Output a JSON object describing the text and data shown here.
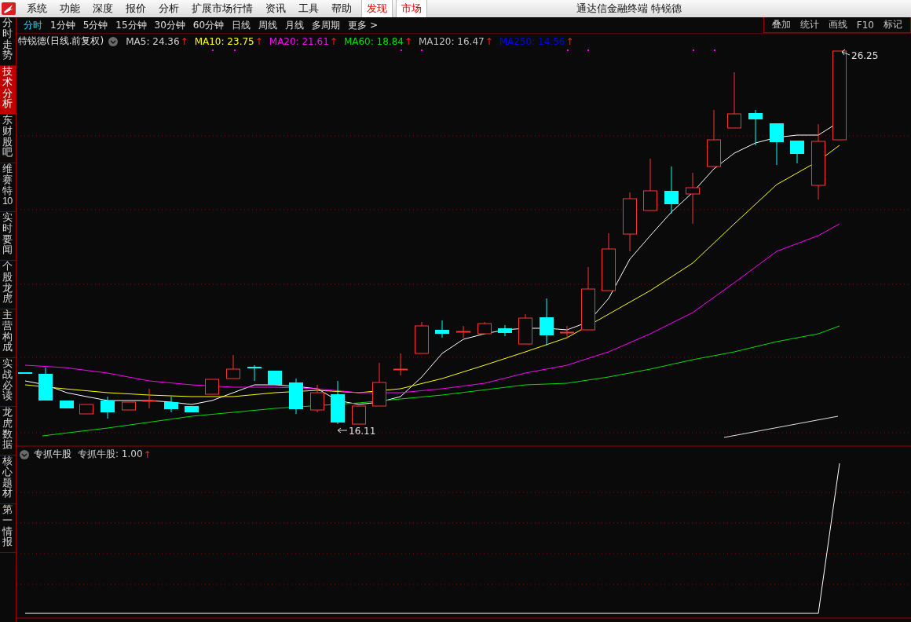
{
  "menu_bar": {
    "items": [
      "系统",
      "功能",
      "深度",
      "报价",
      "分析",
      "扩展市场行情",
      "资讯",
      "工具",
      "帮助"
    ],
    "highlight_items": [
      "发现",
      "市场"
    ],
    "title": "通达信金融终端  特锐德"
  },
  "period_tabs": [
    {
      "label": "分时",
      "selected": true
    },
    {
      "label": "1分钟",
      "selected": false
    },
    {
      "label": "5分钟",
      "selected": false
    },
    {
      "label": "15分钟",
      "selected": false
    },
    {
      "label": "30分钟",
      "selected": false
    },
    {
      "label": "60分钟",
      "selected": false
    },
    {
      "label": "日线",
      "selected": false
    },
    {
      "label": "周线",
      "selected": false
    },
    {
      "label": "月线",
      "selected": false
    },
    {
      "label": "多周期",
      "selected": false
    },
    {
      "label": "更多 >",
      "selected": false
    }
  ],
  "tool_buttons": [
    "叠加",
    "统计",
    "画线",
    "F10",
    "标记"
  ],
  "sidebar": {
    "items": [
      {
        "label": "分时走势",
        "selected": false
      },
      {
        "label": "技术分析",
        "selected": true
      },
      {
        "label": "东财股吧",
        "selected": false
      },
      {
        "label": "维赛特10",
        "selected": false
      },
      {
        "label": "实时要闻",
        "selected": false
      },
      {
        "label": "个股龙虎",
        "selected": false
      },
      {
        "label": "主营构成",
        "selected": false
      },
      {
        "label": "实战必读",
        "selected": false
      },
      {
        "label": "龙虎数据",
        "selected": false
      },
      {
        "label": "核心题材",
        "selected": false
      },
      {
        "label": "第一情报",
        "selected": false
      }
    ]
  },
  "main_chart": {
    "title": "特锐德(日线.前复权)",
    "indicators": [
      {
        "label": "MA5: 24.36",
        "arrow": "↑",
        "color": "#d0d0d0"
      },
      {
        "label": "MA10: 23.75",
        "arrow": "↑",
        "color": "#ffff00"
      },
      {
        "label": "MA20: 21.61",
        "arrow": "↑",
        "color": "#ff00ff"
      },
      {
        "label": "MA60: 18.84",
        "arrow": "↑",
        "color": "#00e000"
      },
      {
        "label": "MA120: 16.47",
        "arrow": "↑",
        "color": "#c0c0c0"
      },
      {
        "label": "MA250: 14.56",
        "arrow": "↑",
        "color": "#0000ff"
      }
    ],
    "high_label": "26.25",
    "low_label": "16.11"
  },
  "sub_chart": {
    "title": "专抓牛股",
    "indicator": {
      "label": "专抓牛股: 1.00",
      "arrow": "↑",
      "color": "#d0d0d0"
    }
  }
}
